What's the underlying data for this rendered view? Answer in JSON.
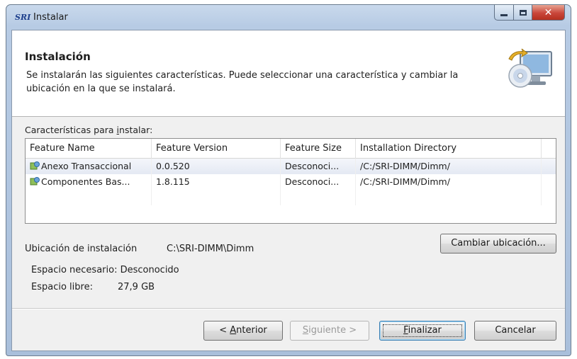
{
  "window": {
    "app_icon_text": "SRI",
    "title": "Instalar"
  },
  "header": {
    "title": "Instalación",
    "description": "Se instalarán las siguientes características. Puede seleccionar una característica y cambiar la ubicación en la que se instalará."
  },
  "features": {
    "label_pre": "Características para ",
    "label_mnemonic": "i",
    "label_post": "nstalar:",
    "columns": [
      "Feature Name",
      "Feature Version",
      "Feature Size",
      "Installation Directory"
    ],
    "rows": [
      {
        "name": "Anexo Transaccional",
        "version": "0.0.520",
        "size": "Desconoci...",
        "dir": "/C:/SRI-DIMM/Dimm/"
      },
      {
        "name": "Componentes Bas...",
        "version": "1.8.115",
        "size": "Desconoci...",
        "dir": "/C:/SRI-DIMM/Dimm/"
      }
    ]
  },
  "location": {
    "label": "Ubicación de instalación",
    "value": "C:\\SRI-DIMM\\Dimm",
    "change_button": "Cambiar ubicación..."
  },
  "space": {
    "needed": "Espacio necesario: Desconocido",
    "free_label": "Espacio libre:",
    "free_value": "27,9 GB"
  },
  "buttons": {
    "back_pre": "< ",
    "back_mnemonic": "A",
    "back_post": "nterior",
    "next_mnemonic": "S",
    "next_post": "iguiente >",
    "finish_mnemonic": "F",
    "finish_post": "inalizar",
    "cancel": "Cancelar"
  },
  "colors": {
    "titlebar": "#b7cbe4",
    "close_button": "#c9463a",
    "dialog_background": "#f0f0f0"
  },
  "icons": [
    "app-logo-icon",
    "minimize-icon",
    "maximize-icon",
    "close-icon",
    "installer-computer-icon",
    "feature-package-icon"
  ]
}
